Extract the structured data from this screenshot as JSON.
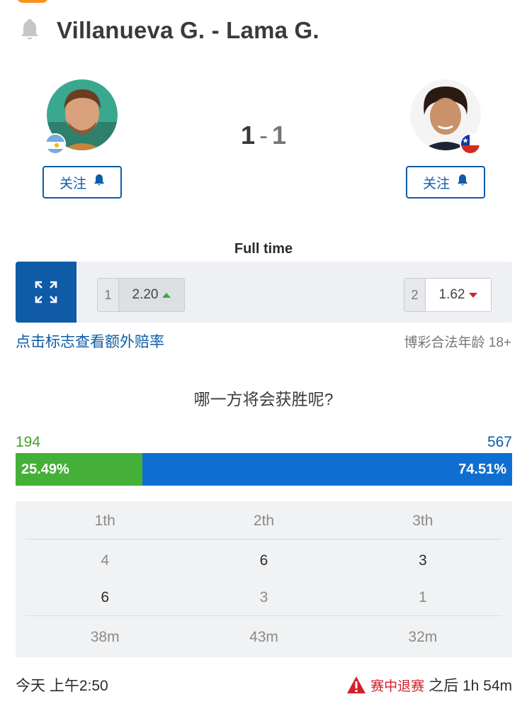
{
  "header": {
    "title": "Villanueva G. - Lama G."
  },
  "players": {
    "home": {
      "follow_label": "关注",
      "flag": "argentina-flag"
    },
    "away": {
      "follow_label": "关注",
      "flag": "chile-flag"
    }
  },
  "score": {
    "home": "1",
    "separator": "-",
    "away": "1"
  },
  "odds": {
    "period": "Full time",
    "home": {
      "index": "1",
      "value": "2.20",
      "trend": "up"
    },
    "away": {
      "index": "2",
      "value": "1.62",
      "trend": "down"
    },
    "extra_link": "点击标志查看额外赔率",
    "legal_age": "博彩合法年龄 18+"
  },
  "vote": {
    "question": "哪一方将会获胜呢?",
    "home_count": "194",
    "away_count": "567",
    "home_percent": "25.49%",
    "away_percent": "74.51%",
    "home_fraction": 0.2549
  },
  "sets": {
    "headers": [
      "1th",
      "2th",
      "3th"
    ],
    "home": [
      "4",
      "6",
      "3"
    ],
    "away": [
      "6",
      "3",
      "1"
    ],
    "durations": [
      "38m",
      "43m",
      "32m"
    ]
  },
  "footer": {
    "date": "今天 上午2:50",
    "status": "赛中退赛",
    "after": "之后 1h 54m"
  },
  "colors": {
    "brand_blue": "#0f5ba7",
    "vote_green": "#45b037",
    "vote_blue": "#0f6fd1",
    "alert_red": "#d4202c"
  }
}
